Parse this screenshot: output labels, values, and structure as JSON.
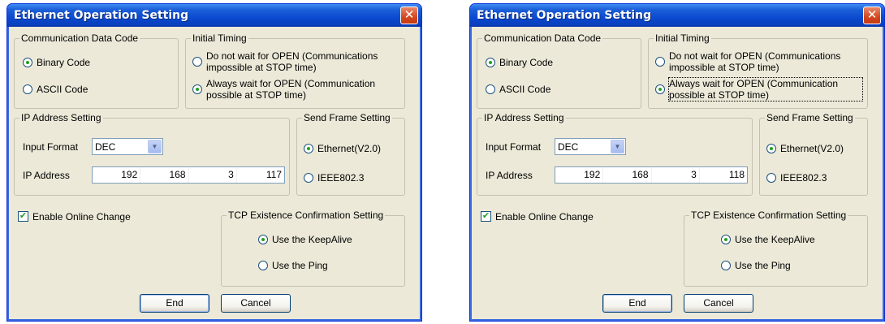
{
  "dialogs": [
    {
      "title": "Ethernet Operation Setting",
      "close_icon": "✕",
      "comm_code": {
        "legend": "Communication Data Code",
        "binary": "Binary Code",
        "ascii": "ASCII Code",
        "selected": "binary"
      },
      "initial_timing": {
        "legend": "Initial Timing",
        "no_wait": "Do not wait for OPEN (Communications impossible at STOP time)",
        "always_wait": "Always wait for OPEN (Communication possible at STOP time)",
        "selected": "always_wait"
      },
      "ip_setting": {
        "legend": "IP Address Setting",
        "input_format_label": "Input Format",
        "input_format_value": "DEC",
        "ip_label": "IP Address",
        "octets": [
          "192",
          "168",
          "3",
          "117"
        ]
      },
      "send_frame": {
        "legend": "Send Frame Setting",
        "ethernet": "Ethernet(V2.0)",
        "ieee": "IEEE802.3",
        "selected": "ethernet"
      },
      "online_change": {
        "label": "Enable Online Change",
        "checked": true
      },
      "tcp": {
        "legend": "TCP Existence Confirmation Setting",
        "keepalive": "Use the KeepAlive",
        "ping": "Use the Ping",
        "selected": "keepalive"
      },
      "buttons": {
        "end": "End",
        "cancel": "Cancel"
      }
    },
    {
      "title": "Ethernet Operation Setting",
      "close_icon": "✕",
      "comm_code": {
        "legend": "Communication Data Code",
        "binary": "Binary Code",
        "ascii": "ASCII Code",
        "selected": "binary"
      },
      "initial_timing": {
        "legend": "Initial Timing",
        "no_wait": "Do not wait for OPEN (Communications impossible at STOP time)",
        "always_wait": "Always wait for OPEN (Communication possible at STOP time)",
        "selected": "always_wait"
      },
      "ip_setting": {
        "legend": "IP Address Setting",
        "input_format_label": "Input Format",
        "input_format_value": "DEC",
        "ip_label": "IP Address",
        "octets": [
          "192",
          "168",
          "3",
          "118"
        ]
      },
      "send_frame": {
        "legend": "Send Frame Setting",
        "ethernet": "Ethernet(V2.0)",
        "ieee": "IEEE802.3",
        "selected": "ethernet"
      },
      "online_change": {
        "label": "Enable Online Change",
        "checked": true
      },
      "tcp": {
        "legend": "TCP Existence Confirmation Setting",
        "keepalive": "Use the KeepAlive",
        "ping": "Use the Ping",
        "selected": "keepalive"
      },
      "buttons": {
        "end": "End",
        "cancel": "Cancel"
      }
    }
  ],
  "colors": {
    "titlebar": "#0b4ad0",
    "face": "#ece9d8",
    "close": "#d5471e",
    "radio_dot": "#21a121"
  },
  "icons": {
    "close": "close-icon",
    "dropdown": "chevron-down-icon",
    "check": "checkmark-icon"
  }
}
